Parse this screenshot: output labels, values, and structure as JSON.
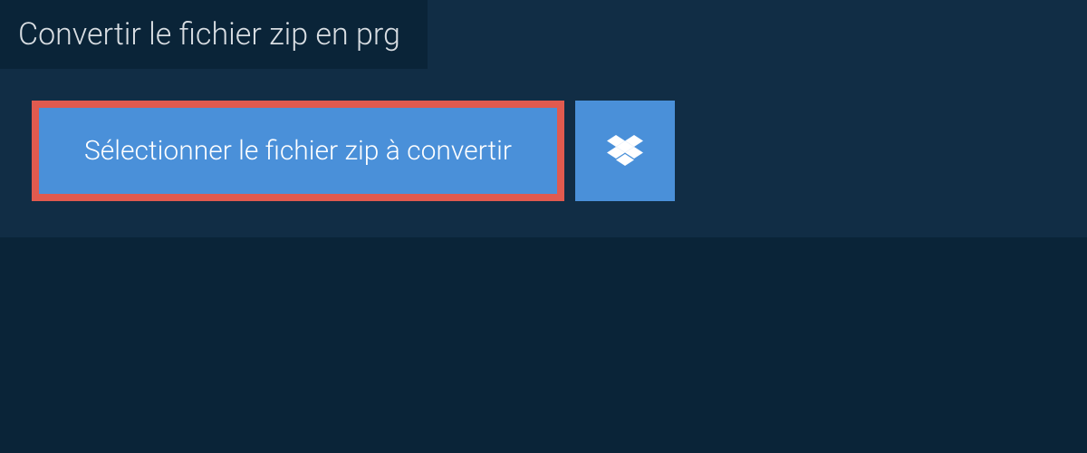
{
  "header": {
    "title": "Convertir le fichier zip en prg"
  },
  "actions": {
    "select_file_label": "Sélectionner le fichier zip à convertir"
  },
  "colors": {
    "page_bg": "#0a2438",
    "panel_bg": "#112d45",
    "button_bg": "#4a90d9",
    "highlight_border": "#e05a4f",
    "text_light": "#d8dde2",
    "text_white": "#ffffff"
  }
}
